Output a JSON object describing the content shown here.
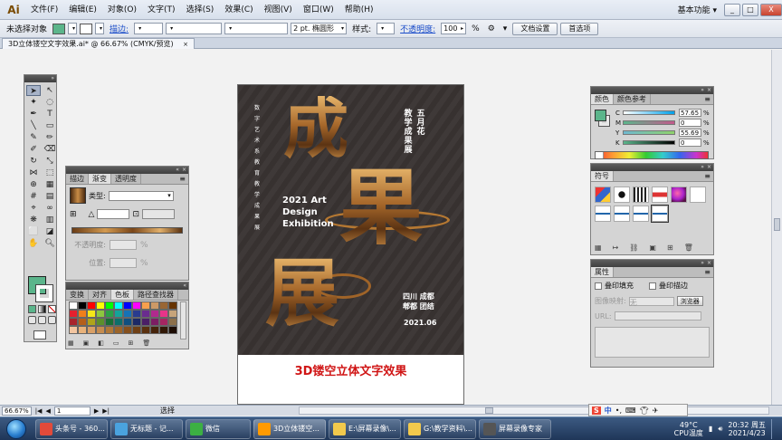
{
  "app": {
    "logo": "Ai",
    "menus": [
      "文件(F)",
      "编辑(E)",
      "对象(O)",
      "文字(T)",
      "选择(S)",
      "效果(C)",
      "视图(V)",
      "窗口(W)",
      "帮助(H)"
    ],
    "workspace": "基本功能 ▾",
    "window_controls": [
      "_",
      "□",
      "X"
    ]
  },
  "control_bar": {
    "selection_label": "未选择对象",
    "stroke_link": "描边:",
    "stroke_width": "2 pt. 椭圆形",
    "style_label": "样式:",
    "opacity_link": "不透明度:",
    "opacity_value": "100",
    "opacity_unit": "%",
    "doc_setup": "文档设置",
    "preferences": "首选项"
  },
  "document_tab": {
    "title": "3D立体镂空文字效果.ai* @ 66.67% (CMYK/预览)",
    "close": "×"
  },
  "artwork": {
    "vertical_text": "数字艺术系教育教学成果展",
    "title_col1": "五月花",
    "title_col2": "教学成果展",
    "en_title_line1": "2021 Art",
    "en_title_line2": "Design",
    "en_title_line3": "Exhibition",
    "char_cheng": "成",
    "char_guo": "果",
    "char_zhan": "展",
    "sign_line1": "四川 成都",
    "sign_line2": "郫都 团结",
    "date": "2021.06",
    "caption": "3D镂空立体文字效果"
  },
  "gradient_panel": {
    "tabs": [
      "描边",
      "渐变",
      "透明度"
    ],
    "active_tab": "渐变",
    "type_label": "类型:",
    "opacity_label": "不透明度:",
    "opacity_unit": "%",
    "location_label": "位置:",
    "location_unit": "%"
  },
  "swatches_panel": {
    "tabs": [
      "变换",
      "对齐",
      "色板",
      "路径查找器"
    ],
    "active_tab": "色板",
    "colors": [
      "#ffffff",
      "#000000",
      "#ff0000",
      "#ffff00",
      "#00ff00",
      "#00ffff",
      "#0000ff",
      "#ff00ff",
      "#f6a04d",
      "#cc9966",
      "#996633",
      "#663300",
      "#e5202e",
      "#ef7f1a",
      "#f4e61a",
      "#8cc63f",
      "#2b9f47",
      "#14a39a",
      "#1572b6",
      "#293b8f",
      "#6a2c8f",
      "#b02a8d",
      "#e73489",
      "#c7a47a",
      "#a8242c",
      "#b55f1a",
      "#b0a41a",
      "#5c8f2b",
      "#1a6e35",
      "#0d6f6a",
      "#0e4f80",
      "#1c2966",
      "#4b1f66",
      "#7c1d63",
      "#a52561",
      "#8c6f4a",
      "#f2c5a0",
      "#e8b27a",
      "#d9a066",
      "#c58c4f",
      "#b07838",
      "#9b6429",
      "#85501d",
      "#6f3f14",
      "#5a300e",
      "#45230a",
      "#301705",
      "#1c0c02"
    ]
  },
  "color_panel": {
    "tabs": [
      "颜色",
      "颜色参考"
    ],
    "active_tab": "颜色",
    "channels": [
      {
        "name": "C",
        "value": "57.65",
        "unit": "%",
        "gradient": [
          "#ffffff",
          "#00a0e9"
        ]
      },
      {
        "name": "M",
        "value": "0",
        "unit": "%",
        "gradient": [
          "#5bb58b",
          "#c2598b"
        ]
      },
      {
        "name": "Y",
        "value": "55.69",
        "unit": "%",
        "gradient": [
          "#6fb8d0",
          "#8ed16a"
        ]
      },
      {
        "name": "K",
        "value": "0",
        "unit": "%",
        "gradient": [
          "#5bb58b",
          "#000000"
        ]
      }
    ],
    "fill_color": "#5bb58b"
  },
  "symbols_panel": {
    "tabs": [
      "符号"
    ],
    "active_tab": "符号"
  },
  "attributes_panel": {
    "tabs": [
      "属性"
    ],
    "active_tab": "属性",
    "overprint_fill": "叠印填充",
    "overprint_stroke": "叠印描边",
    "image_map_label": "图像映射:",
    "image_map_value": "无",
    "browser_btn": "浏览器",
    "url_label": "URL:"
  },
  "status_bar": {
    "zoom": "66.67%",
    "nav_first": "|◀",
    "nav_prev": "◀",
    "page": "1",
    "nav_next": "▶",
    "nav_last": "▶|",
    "status": "选择"
  },
  "ime": {
    "s_label": "S",
    "mode": "中",
    "punct": "•,"
  },
  "taskbar": {
    "tasks": [
      {
        "label": "头条号 - 360...",
        "color": "#e24a3a"
      },
      {
        "label": "无标题 - 记...",
        "color": "#4aa3df"
      },
      {
        "label": "微信",
        "color": "#3cb043"
      },
      {
        "label": "3D立体镂空...",
        "color": "#ff9a00"
      },
      {
        "label": "E:\\屏幕录像\\...",
        "color": "#f2c94c"
      },
      {
        "label": "G:\\教学资料\\...",
        "color": "#f2c94c"
      },
      {
        "label": "屏幕录像专家",
        "color": "#555555"
      }
    ],
    "active_index": 3,
    "temperature": "49°C",
    "temp_label": "CPU温度",
    "time": "20:32 周五",
    "date": "2021/4/23"
  }
}
